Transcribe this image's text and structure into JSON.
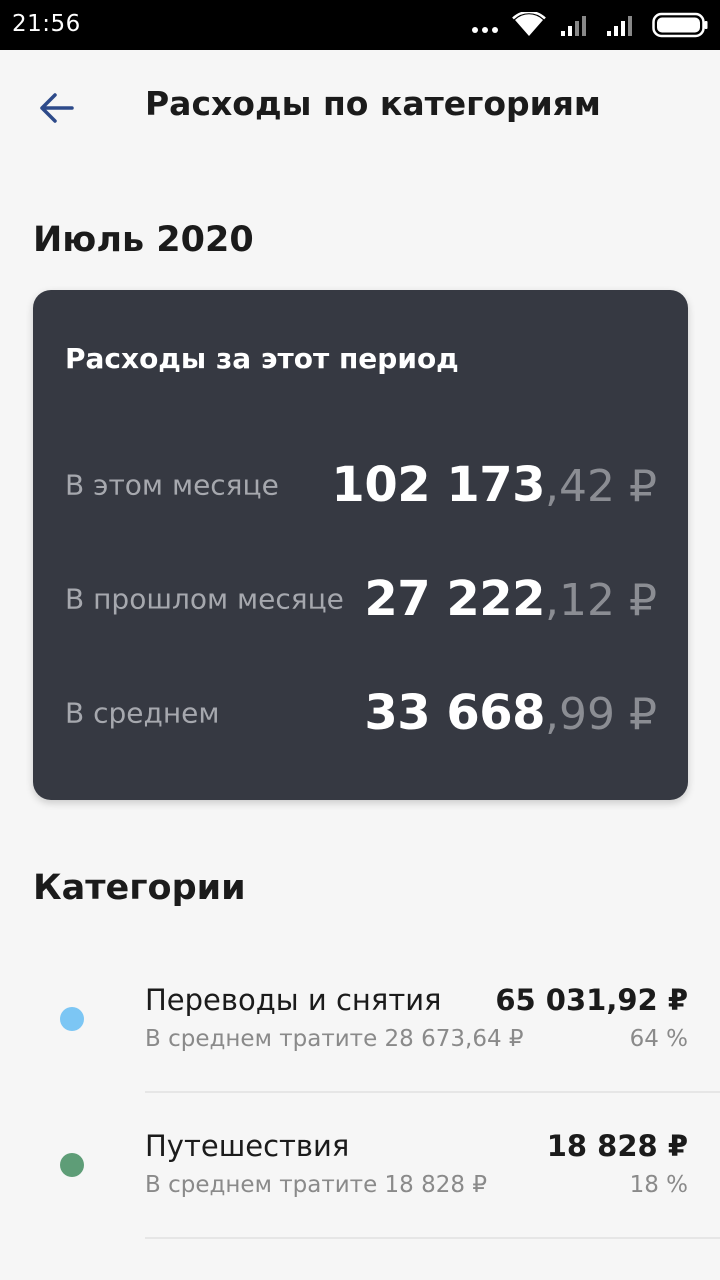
{
  "status_bar": {
    "time": "21:56",
    "icons": [
      "more-dots-icon",
      "wifi-icon",
      "signal-icon",
      "signal-icon",
      "battery-icon"
    ]
  },
  "app_bar": {
    "back_icon": "arrow-left-icon",
    "title": "Расходы по категориям"
  },
  "period": {
    "title": "Июль 2020"
  },
  "summary_card": {
    "title": "Расходы за этот период",
    "rows": [
      {
        "label": "В этом месяце",
        "integer": "102 173",
        "decimal": ",42 ₽"
      },
      {
        "label": "В прошлом месяце",
        "integer": "27 222",
        "decimal": ",12 ₽"
      },
      {
        "label": "В среднем",
        "integer": "33 668",
        "decimal": ",99 ₽"
      }
    ]
  },
  "categories": {
    "title": "Категории",
    "items": [
      {
        "name": "Переводы и снятия",
        "average": "В среднем тратите 28 673,64 ₽",
        "amount": "65 031,92 ₽",
        "percent": "64 %",
        "color": "#7cc6f4"
      },
      {
        "name": "Путешествия",
        "average": "В среднем тратите 18 828 ₽",
        "amount": "18 828 ₽",
        "percent": "18 %",
        "color": "#5e9d77"
      }
    ]
  },
  "colors": {
    "card_background": "#363942",
    "page_background": "#f6f6f6",
    "back_arrow": "#2d4a8a"
  }
}
